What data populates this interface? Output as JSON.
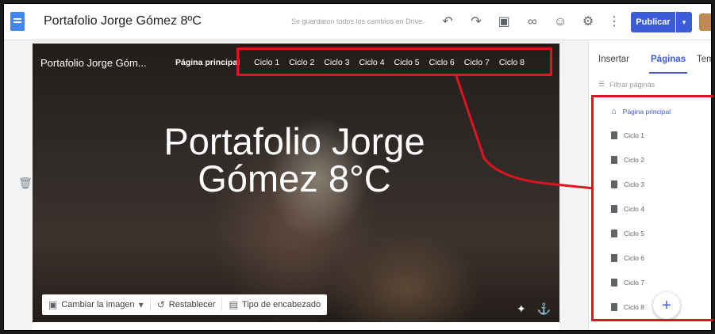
{
  "topbar": {
    "title": "Portafolio Jorge Gómez 8ºC",
    "save_status": "Se guardaron todos los cambios en Drive.",
    "publish_label": "Publicar",
    "icons": [
      "undo-icon",
      "redo-icon",
      "preview-icon",
      "link-icon",
      "share-icon",
      "settings-icon",
      "more-icon"
    ]
  },
  "hero": {
    "site_name": "Portafolio Jorge Góm...",
    "title": "Portafolio Jorge Gómez 8°C",
    "nav": [
      "Página principal",
      "Ciclo 1",
      "Ciclo 2",
      "Ciclo 3",
      "Ciclo 4",
      "Ciclo 5",
      "Ciclo 6",
      "Ciclo 7",
      "Ciclo 8"
    ],
    "toolbar": {
      "change_image": "Cambiar la imagen",
      "reset": "Restablecer",
      "header_type": "Tipo de encabezado"
    }
  },
  "panel": {
    "tabs": [
      "Insertar",
      "Páginas",
      "Temas"
    ],
    "active_tab": "Páginas",
    "filter_placeholder": "Filtrar páginas",
    "pages": [
      "Página principal",
      "Ciclo 1",
      "Ciclo 2",
      "Ciclo 3",
      "Ciclo 4",
      "Ciclo 5",
      "Ciclo 6",
      "Ciclo 7",
      "Ciclo 8"
    ]
  },
  "colors": {
    "accent": "#3c5bd6",
    "annotation": "#e0141e"
  }
}
